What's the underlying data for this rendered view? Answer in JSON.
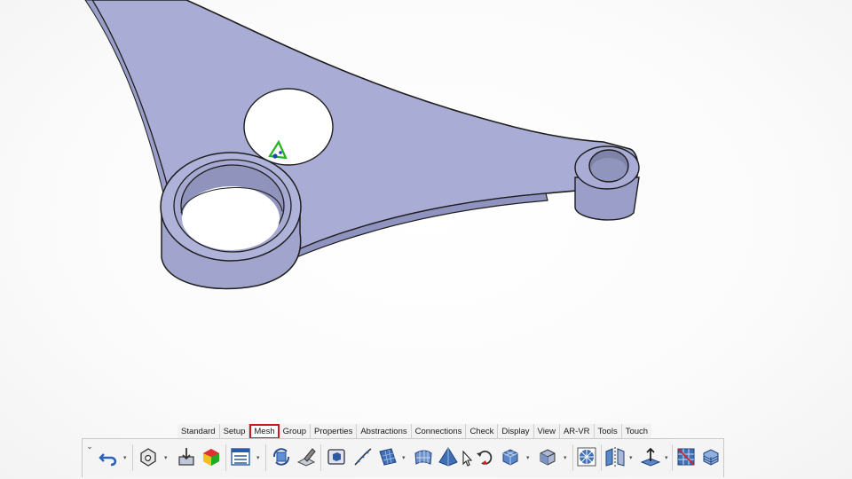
{
  "viewport": {
    "model": "triangular bracket with bearing boss"
  },
  "ribbon": {
    "tabs": [
      {
        "label": "Standard",
        "active": false
      },
      {
        "label": "Setup",
        "active": false
      },
      {
        "label": "Mesh",
        "active": true
      },
      {
        "label": "Group",
        "active": false
      },
      {
        "label": "Properties",
        "active": false
      },
      {
        "label": "Abstractions",
        "active": false
      },
      {
        "label": "Connections",
        "active": false
      },
      {
        "label": "Check",
        "active": false
      },
      {
        "label": "Display",
        "active": false
      },
      {
        "label": "View",
        "active": false
      },
      {
        "label": "AR-VR",
        "active": false
      },
      {
        "label": "Tools",
        "active": false
      },
      {
        "label": "Touch",
        "active": false
      }
    ],
    "highlight_color": "#d01818"
  },
  "toolbar": {
    "tools": [
      "undo-icon",
      "geometry-cleanup-icon",
      "import-icon",
      "quality-contour-icon",
      "list-view-icon",
      "refresh-mesh-icon",
      "edit-mesh-icon",
      "volume-box-icon",
      "line-mesh-icon",
      "surface-mesh-icon",
      "shell-mesh-icon",
      "tetra-mesh-icon",
      "select-cursor-icon",
      "rotate-arrow-icon",
      "hexa-block-icon",
      "solid-cube-icon",
      "spider-mesh-icon",
      "mirror-plane-icon",
      "translate-axis-icon",
      "grid-mesh-icon",
      "layered-box-icon"
    ]
  },
  "colors": {
    "part_fill": "#a9acd4",
    "part_shadow": "#8f93bf",
    "edge": "#1e1e1e",
    "marker_green": "#22b422",
    "marker_blue": "#2244bb"
  }
}
